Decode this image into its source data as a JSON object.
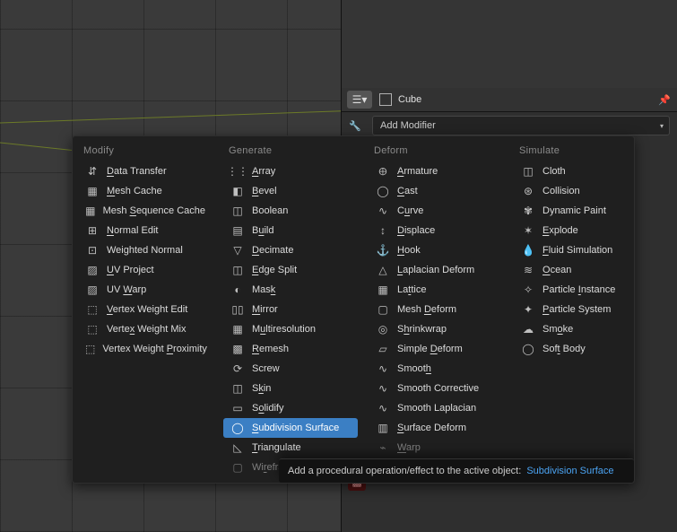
{
  "header": {
    "object_name": "Cube",
    "add_modifier_label": "Add Modifier"
  },
  "popup": {
    "tooltip_prefix": "Add a procedural operation/effect to the active object:",
    "tooltip_link": "Subdivision Surface",
    "columns": [
      {
        "title": "Modify",
        "items": [
          {
            "icon": "data-transfer-icon",
            "glyph": "⇵",
            "label": "Data Transfer",
            "ul": 0
          },
          {
            "icon": "mesh-cache-icon",
            "glyph": "▦",
            "label": "Mesh Cache",
            "ul": 0
          },
          {
            "icon": "mesh-seq-cache-icon",
            "glyph": "▦",
            "label": "Mesh Sequence Cache",
            "ul": 5
          },
          {
            "icon": "normal-edit-icon",
            "glyph": "⊞",
            "label": "Normal Edit",
            "ul": 0
          },
          {
            "icon": "weighted-normal-icon",
            "glyph": "⊡",
            "label": "Weighted Normal"
          },
          {
            "icon": "uv-project-icon",
            "glyph": "▨",
            "label": "UV Project",
            "ul": 0
          },
          {
            "icon": "uv-warp-icon",
            "glyph": "▨",
            "label": "UV Warp",
            "ul": 3
          },
          {
            "icon": "vtx-weight-edit-icon",
            "glyph": "⬚",
            "label": "Vertex Weight Edit",
            "ul": 0
          },
          {
            "icon": "vtx-weight-mix-icon",
            "glyph": "⬚",
            "label": "Vertex Weight Mix",
            "ul": 5
          },
          {
            "icon": "vtx-weight-prox-icon",
            "glyph": "⬚",
            "label": "Vertex Weight Proximity",
            "ul": 14
          }
        ]
      },
      {
        "title": "Generate",
        "items": [
          {
            "icon": "array-icon",
            "glyph": "⋮⋮",
            "label": "Array",
            "ul": 0
          },
          {
            "icon": "bevel-icon",
            "glyph": "◧",
            "label": "Bevel",
            "ul": 0
          },
          {
            "icon": "boolean-icon",
            "glyph": "◫",
            "label": "Boolean"
          },
          {
            "icon": "build-icon",
            "glyph": "▤",
            "label": "Build",
            "ul": 1
          },
          {
            "icon": "decimate-icon",
            "glyph": "▽",
            "label": "Decimate",
            "ul": 0
          },
          {
            "icon": "edge-split-icon",
            "glyph": "◫",
            "label": "Edge Split",
            "ul": 0
          },
          {
            "icon": "mask-icon",
            "glyph": "◐",
            "label": "Mask",
            "ul": 3
          },
          {
            "icon": "mirror-icon",
            "glyph": "▯▯",
            "label": "Mirror",
            "ul": 0
          },
          {
            "icon": "multires-icon",
            "glyph": "▦",
            "label": "Multiresolution",
            "ul": 1
          },
          {
            "icon": "remesh-icon",
            "glyph": "▩",
            "label": "Remesh",
            "ul": 0
          },
          {
            "icon": "screw-icon",
            "glyph": "⟳",
            "label": "Screw"
          },
          {
            "icon": "skin-icon",
            "glyph": "◫",
            "label": "Skin",
            "ul": 1
          },
          {
            "icon": "solidify-icon",
            "glyph": "▭",
            "label": "Solidify",
            "ul": 1
          },
          {
            "icon": "subsurf-icon",
            "glyph": "◯",
            "label": "Subdivision Surface",
            "ul": 0,
            "selected": true
          },
          {
            "icon": "triangulate-icon",
            "glyph": "◺",
            "label": "Triangulate",
            "ul": 0
          },
          {
            "icon": "wireframe-icon",
            "glyph": "▢",
            "label": "Wireframe",
            "ul": 2,
            "faded": true
          }
        ]
      },
      {
        "title": "Deform",
        "items": [
          {
            "icon": "armature-icon",
            "glyph": "𐀏",
            "label": "Armature",
            "ul": 0
          },
          {
            "icon": "cast-icon",
            "glyph": "◯",
            "label": "Cast",
            "ul": 0
          },
          {
            "icon": "curve-icon",
            "glyph": "∿",
            "label": "Curve",
            "ul": 1
          },
          {
            "icon": "displace-icon",
            "glyph": "↕",
            "label": "Displace",
            "ul": 0
          },
          {
            "icon": "hook-icon",
            "glyph": "⚓",
            "label": "Hook",
            "ul": 0
          },
          {
            "icon": "laplacian-deform-icon",
            "glyph": "△",
            "label": "Laplacian Deform",
            "ul": 0
          },
          {
            "icon": "lattice-icon",
            "glyph": "▦",
            "label": "Lattice",
            "ul": 2
          },
          {
            "icon": "mesh-deform-icon",
            "glyph": "▢",
            "label": "Mesh Deform",
            "ul": 5
          },
          {
            "icon": "shrinkwrap-icon",
            "glyph": "◎",
            "label": "Shrinkwrap",
            "ul": 1
          },
          {
            "icon": "simple-deform-icon",
            "glyph": "▱",
            "label": "Simple Deform",
            "ul": 7
          },
          {
            "icon": "smooth-icon",
            "glyph": "∿",
            "label": "Smooth",
            "ul": 5
          },
          {
            "icon": "smooth-corr-icon",
            "glyph": "∿",
            "label": "Smooth Corrective"
          },
          {
            "icon": "smooth-lap-icon",
            "glyph": "∿",
            "label": "Smooth Laplacian"
          },
          {
            "icon": "surface-deform-icon",
            "glyph": "▥",
            "label": "Surface Deform",
            "ul": 0
          },
          {
            "icon": "warp-icon",
            "glyph": "⌁",
            "label": "Warp",
            "ul": 0,
            "faded": true
          }
        ]
      },
      {
        "title": "Simulate",
        "items": [
          {
            "icon": "cloth-icon",
            "glyph": "◫",
            "label": "Cloth"
          },
          {
            "icon": "collision-icon",
            "glyph": "⊛",
            "label": "Collision"
          },
          {
            "icon": "dyn-paint-icon",
            "glyph": "✾",
            "label": "Dynamic Paint"
          },
          {
            "icon": "explode-icon",
            "glyph": "✶",
            "label": "Explode",
            "ul": 0
          },
          {
            "icon": "fluid-icon",
            "glyph": "💧",
            "label": "Fluid Simulation",
            "ul": 0
          },
          {
            "icon": "ocean-icon",
            "glyph": "≋",
            "label": "Ocean",
            "ul": 0
          },
          {
            "icon": "particle-inst-icon",
            "glyph": "✧",
            "label": "Particle Instance",
            "ul": 9
          },
          {
            "icon": "particle-sys-icon",
            "glyph": "✦",
            "label": "Particle System",
            "ul": 0
          },
          {
            "icon": "smoke-icon",
            "glyph": "☁",
            "label": "Smoke",
            "ul": 2
          },
          {
            "icon": "softbody-icon",
            "glyph": "◯",
            "label": "Soft Body",
            "ul": 3
          }
        ]
      }
    ]
  }
}
